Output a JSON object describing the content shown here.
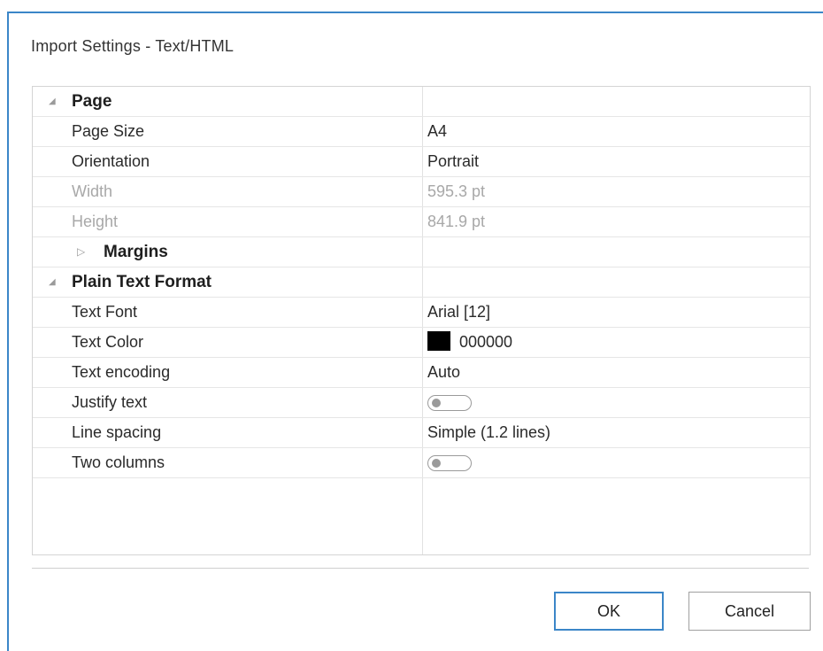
{
  "dialog": {
    "title": "Import Settings - Text/HTML"
  },
  "grid": {
    "page": {
      "label": "Page",
      "page_size": {
        "label": "Page Size",
        "value": "A4"
      },
      "orientation": {
        "label": "Orientation",
        "value": "Portrait"
      },
      "width": {
        "label": "Width",
        "value": "595.3 pt"
      },
      "height": {
        "label": "Height",
        "value": "841.9 pt"
      },
      "margins": {
        "label": "Margins"
      }
    },
    "plain_text": {
      "label": "Plain Text Format",
      "text_font": {
        "label": "Text Font",
        "value": "Arial [12]"
      },
      "text_color": {
        "label": "Text Color",
        "value": "000000",
        "swatch": "#000000"
      },
      "text_encoding": {
        "label": "Text encoding",
        "value": "Auto"
      },
      "justify_text": {
        "label": "Justify text",
        "value": false
      },
      "line_spacing": {
        "label": "Line spacing",
        "value": "Simple (1.2 lines)"
      },
      "two_columns": {
        "label": "Two columns",
        "value": false
      }
    }
  },
  "buttons": {
    "ok": "OK",
    "cancel": "Cancel"
  },
  "colors": {
    "accent": "#3b86c8",
    "disabled_text": "#a8a8a8"
  }
}
